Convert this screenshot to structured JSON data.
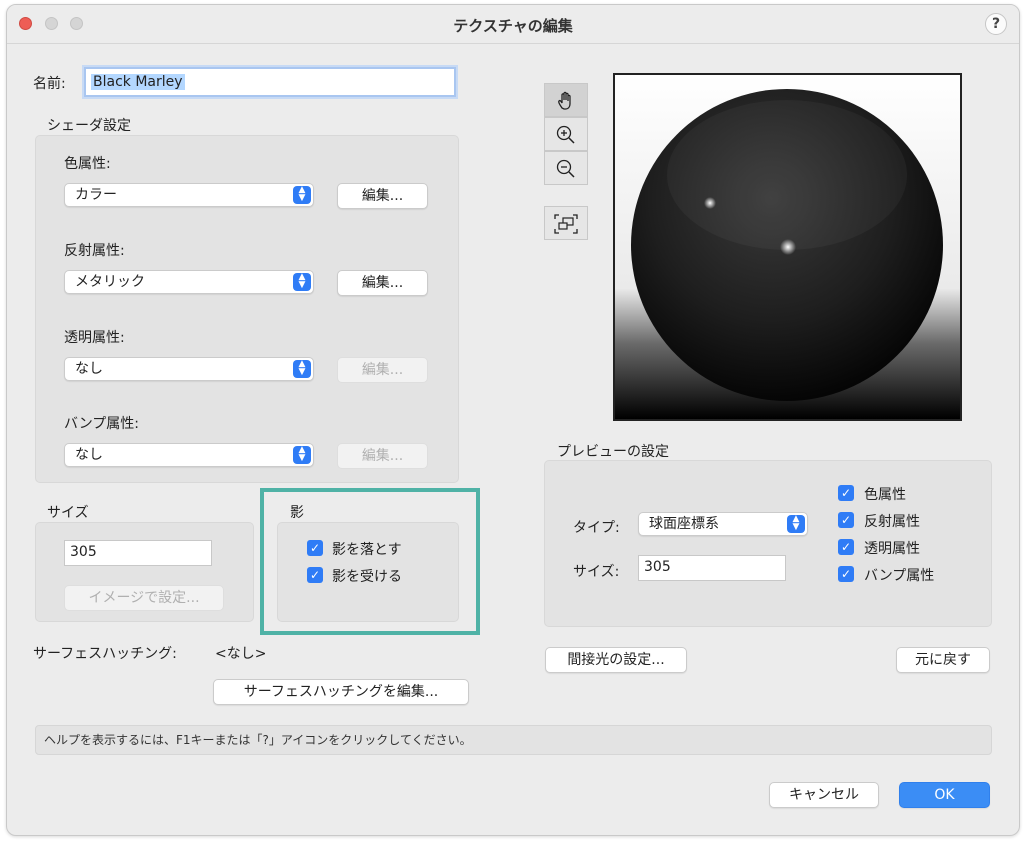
{
  "window": {
    "title": "テクスチャの編集",
    "help_label": "?"
  },
  "name": {
    "label": "名前:",
    "value": "Black Marley"
  },
  "shader": {
    "title": "シェーダ設定",
    "color": {
      "label": "色属性:",
      "value": "カラー",
      "edit_label": "編集..."
    },
    "reflect": {
      "label": "反射属性:",
      "value": "メタリック",
      "edit_label": "編集..."
    },
    "transparent": {
      "label": "透明属性:",
      "value": "なし",
      "edit_label": "編集..."
    },
    "bump": {
      "label": "バンプ属性:",
      "value": "なし",
      "edit_label": "編集..."
    }
  },
  "size": {
    "title": "サイズ",
    "value": "305",
    "image_button": "イメージで設定..."
  },
  "shadow": {
    "title": "影",
    "cast_label": "影を落とす",
    "receive_label": "影を受ける",
    "check": "✓"
  },
  "hatching": {
    "label": "サーフェスハッチング:",
    "value": "<なし>",
    "edit_button": "サーフェスハッチングを編集..."
  },
  "preview_settings": {
    "title": "プレビューの設定",
    "type_label": "タイプ:",
    "type_value": "球面座標系",
    "size_label": "サイズ:",
    "size_value": "305",
    "checks": [
      "色属性",
      "反射属性",
      "透明属性",
      "バンプ属性"
    ]
  },
  "indirect_button": "間接光の設定...",
  "reset_button": "元に戻す",
  "status": "ヘルプを表示するには、F1キーまたは「?」アイコンをクリックしてください。",
  "cancel_button": "キャンセル",
  "ok_button": "OK",
  "colors": {
    "accent": "#2f7cf6",
    "highlight": "#4fb2a6"
  }
}
